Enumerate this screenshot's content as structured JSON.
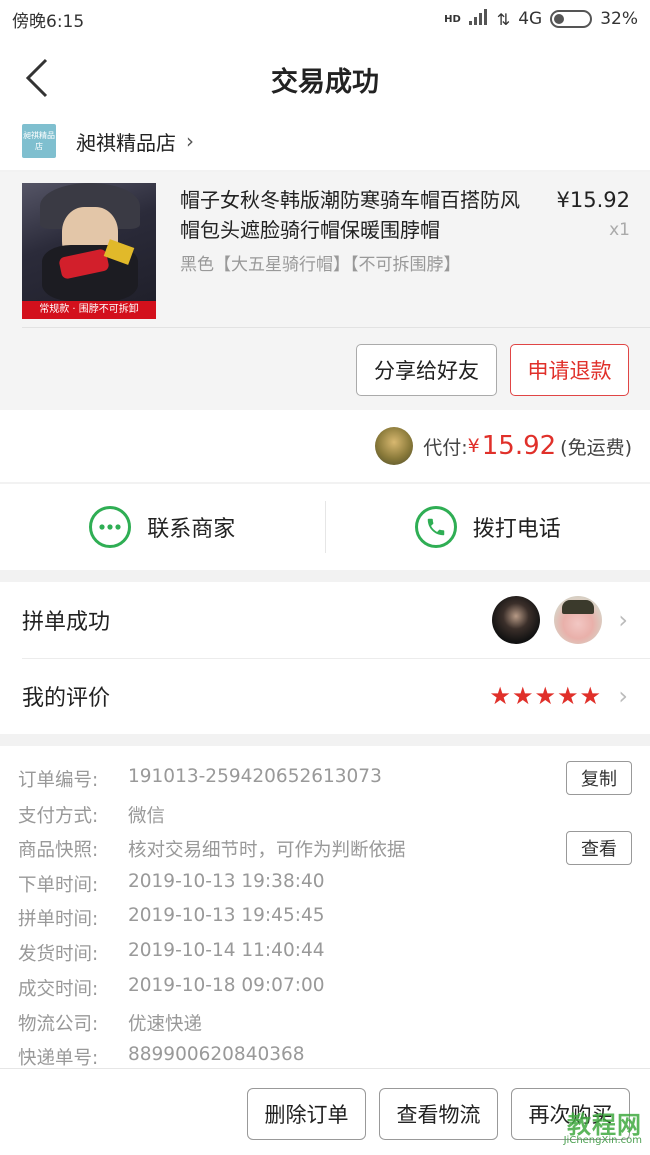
{
  "status_bar": {
    "time": "傍晚6:15",
    "network": "4G",
    "battery": "32%",
    "signal_label": "HD"
  },
  "header": {
    "title": "交易成功"
  },
  "store": {
    "logo_text": "昶祺精品店",
    "name": "昶祺精品店"
  },
  "product": {
    "image_tag": "常规款 · 围脖不可拆卸",
    "title": "帽子女秋冬韩版潮防寒骑车帽百搭防风帽包头遮脸骑行帽保暖围脖帽",
    "spec": "黑色【大五星骑行帽】【不可拆围脖】",
    "price": "¥15.92",
    "quantity": "x1",
    "share_label": "分享给好友",
    "refund_label": "申请退款"
  },
  "payment": {
    "label": "代付:",
    "currency": "¥",
    "amount": "15.92",
    "note": "(免运费)"
  },
  "contact": {
    "merchant_label": "联系商家",
    "call_label": "拨打电话"
  },
  "group": {
    "label": "拼单成功"
  },
  "review": {
    "label": "我的评价",
    "rating": 5,
    "stars": "★★★★★"
  },
  "order": {
    "rows": [
      {
        "key": "订单编号:",
        "value": "191013-259420652613073"
      },
      {
        "key": "支付方式:",
        "value": "微信"
      },
      {
        "key": "商品快照:",
        "value": "核对交易细节时，可作为判断依据"
      },
      {
        "key": "下单时间:",
        "value": "2019-10-13 19:38:40"
      },
      {
        "key": "拼单时间:",
        "value": "2019-10-13 19:45:45"
      },
      {
        "key": "发货时间:",
        "value": "2019-10-14 11:40:44"
      },
      {
        "key": "成交时间:",
        "value": "2019-10-18 09:07:00"
      },
      {
        "key": "物流公司:",
        "value": "优速快递"
      },
      {
        "key": "快递单号:",
        "value": "889900620840368"
      }
    ],
    "copy_label": "复制",
    "view_label": "查看"
  },
  "bottom": {
    "delete_label": "删除订单",
    "logistics_label": "查看物流",
    "rebuy_label": "再次购买"
  },
  "watermark": {
    "main": "教程网",
    "sub": "JiChengXin.com"
  },
  "colors": {
    "accent_red": "#e0302a",
    "wechat_green": "#2fae54"
  }
}
